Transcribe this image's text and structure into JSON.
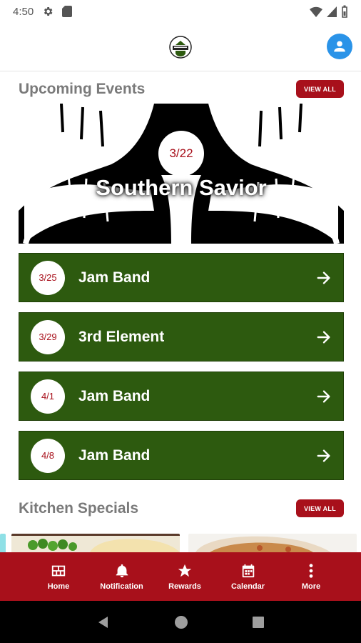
{
  "status_bar": {
    "time": "4:50",
    "icons": [
      "gear-icon",
      "sd-card-icon",
      "wifi-icon",
      "signal-icon",
      "battery-icon"
    ]
  },
  "header": {
    "logo": "restaurant-logo",
    "profile_icon": "account-icon"
  },
  "upcoming_events": {
    "title": "Upcoming Events",
    "view_all_label": "VIEW ALL",
    "featured": {
      "date": "3/22",
      "name": "Southern Savior"
    },
    "items": [
      {
        "date": "3/25",
        "name": "Jam Band"
      },
      {
        "date": "3/29",
        "name": "3rd Element"
      },
      {
        "date": "4/1",
        "name": "Jam Band"
      },
      {
        "date": "4/8",
        "name": "Jam Band"
      }
    ]
  },
  "kitchen_specials": {
    "title": "Kitchen Specials",
    "view_all_label": "VIEW ALL"
  },
  "bottom_nav": {
    "items": [
      {
        "label": "Home",
        "icon": "home-grid-icon"
      },
      {
        "label": "Notification",
        "icon": "bell-icon"
      },
      {
        "label": "Rewards",
        "icon": "star-icon"
      },
      {
        "label": "Calendar",
        "icon": "calendar-icon"
      },
      {
        "label": "More",
        "icon": "more-vertical-icon"
      }
    ]
  },
  "colors": {
    "accent_red": "#a8101b",
    "event_green": "#2d5a0f",
    "profile_blue": "#2a93e8"
  }
}
